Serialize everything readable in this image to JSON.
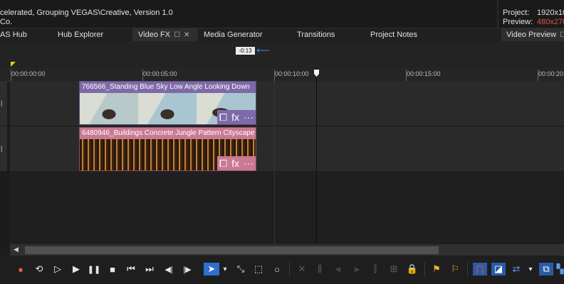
{
  "info": {
    "line1": "celerated, Grouping VEGAS\\Creative, Version 1.0",
    "line2": " Co.",
    "project_label": "Project:",
    "project_value": "1920x10",
    "preview_label": "Preview:",
    "preview_value": "480x270",
    "accent_color": "#e0524a"
  },
  "tabs": [
    {
      "label": "AS Hub"
    },
    {
      "label": "Hub Explorer"
    },
    {
      "label": "Video FX",
      "active": true
    },
    {
      "label": "Media Generator"
    },
    {
      "label": "Transitions"
    },
    {
      "label": "Project Notes"
    },
    {
      "label": "Video Preview"
    }
  ],
  "marker": {
    "label": "-0:13"
  },
  "ruler": {
    "labels": [
      "00:00:00:00",
      "00:00:05:00",
      "00:00:10:00",
      "00:00:15:00",
      "00:00:20"
    ]
  },
  "tracks": {
    "clip1_title": "766566_Standing Blue Sky Low Angle Looking Down",
    "clip2_title": "6480946_Buildings Concrete Jungle Pattern Cityscape",
    "clip1_color": "#7e6aa8",
    "clip2_color": "#c97a92"
  },
  "clip_buttons": {
    "crop": "⧠",
    "fx": "fx",
    "more": "···"
  },
  "toolbar": {
    "record": "●",
    "loop": "⟲",
    "play_from_start": "▷",
    "play": "▶",
    "pause": "❚❚",
    "stop": "■",
    "prev": "⏮",
    "next": "⏭",
    "prev_frame": "◀|",
    "next_frame": "|▶",
    "select": "➤",
    "dropdown": "▾",
    "envelope": "⤡",
    "box_select": "⬚",
    "zoom": "○",
    "cut": "✕",
    "lock": "🔒",
    "marker": "⚑",
    "region": "⚐",
    "snap": "⋂",
    "auto_crossfade": "◪"
  }
}
